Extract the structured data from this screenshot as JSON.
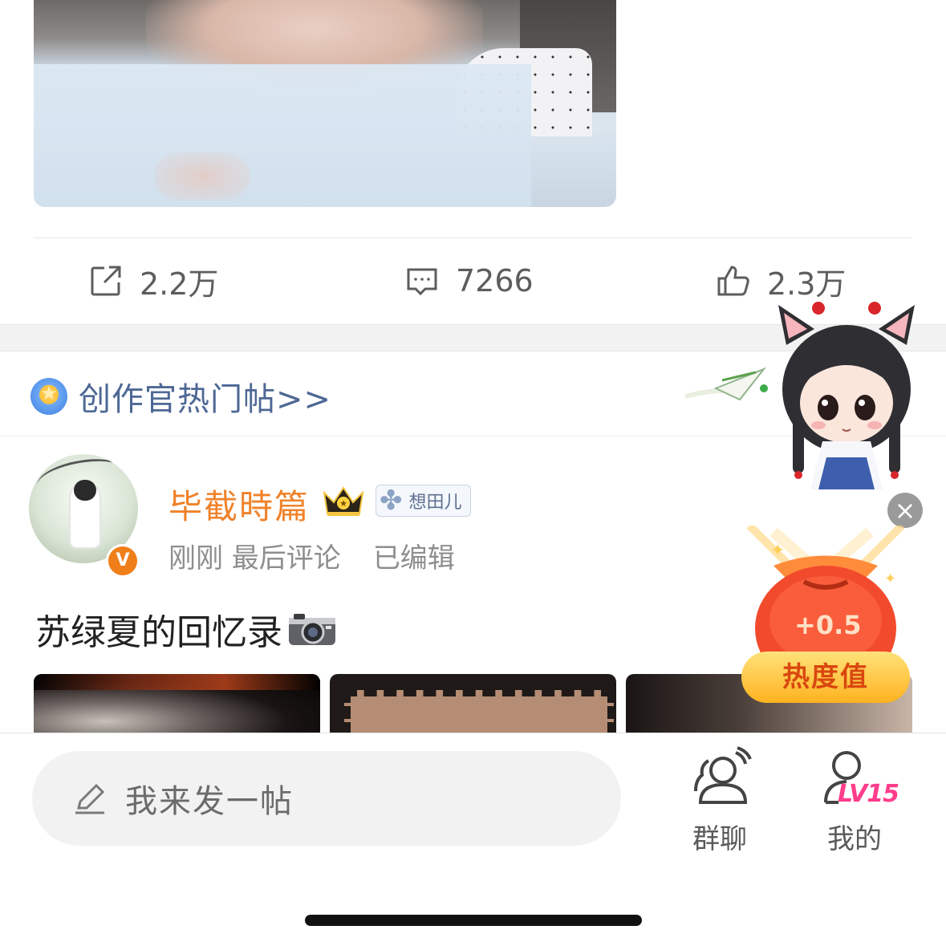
{
  "post_stats": {
    "share_count": "2.2万",
    "comment_count": "7266",
    "like_count": "2.3万"
  },
  "hot_section": {
    "label": "创作官热门帖>>"
  },
  "post": {
    "username": "毕截時篇",
    "tag": "想田儿",
    "time": "刚刚 最后评论",
    "edited": "已编辑",
    "title": "苏绿夏的回忆录",
    "verified_badge": "V"
  },
  "floating": {
    "heat_value": "+0.5",
    "heat_label": "热度值"
  },
  "bottom_bar": {
    "post_placeholder": "我来发一帖",
    "group_chat_label": "群聊",
    "mine_label": "我的",
    "level_badge": "LV15"
  },
  "icons": {
    "share": "share-icon",
    "comment": "comment-icon",
    "like": "like-icon",
    "medal": "medal-icon",
    "crown": "crown-icon",
    "clover": "clover-icon",
    "camera": "camera-icon",
    "pencil": "pencil-icon",
    "group": "group-chat-icon",
    "user": "user-icon",
    "close": "close-icon"
  },
  "colors": {
    "username": "#f0822a",
    "link_blue": "#4d6895",
    "level_pink": "#ff3d8b",
    "heat_orange": "#ffb21f"
  }
}
